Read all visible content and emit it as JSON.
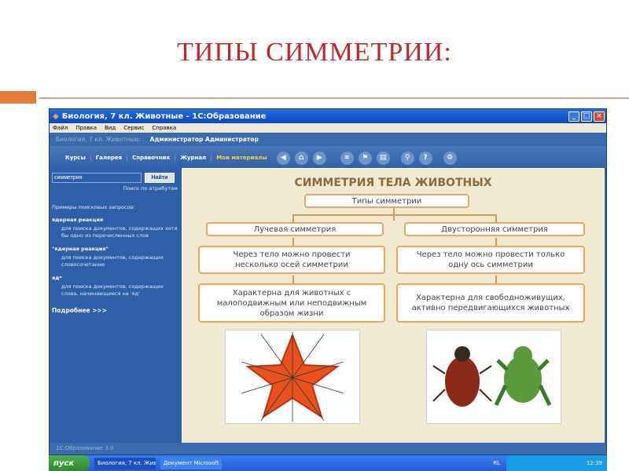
{
  "slide": {
    "title": "ТИПЫ СИММЕТРИИ:"
  },
  "window": {
    "title": "Биология, 7 кл. Животные - 1С:Образование",
    "menu": [
      "Файл",
      "Правка",
      "Вид",
      "Сервис",
      "Справка"
    ],
    "course": "Биология, 7 кл. Животные:",
    "user": "Администратор Администратор",
    "tabs": [
      "Курсы",
      "Галерея",
      "Справочник",
      "Журнал",
      "Мои материалы"
    ],
    "status": "1С:Образование 3.0"
  },
  "sidebar": {
    "search_value": "симметрия",
    "search_button": "Найти",
    "attr_link": "Поиск по атрибутам",
    "examples_title": "Примеры поисковых запросов:",
    "examples": [
      {
        "q": "ядерная реакция",
        "d": "для поиска документов, содержащих хотя бы одно из перечисленных слов"
      },
      {
        "q": "\"ядерная реакция\"",
        "d": "для поиска документов, содержащих словосочетание"
      },
      {
        "q": "яд*",
        "d": "для поиска документов, содержащих слова, начинающиеся на 'яд'"
      }
    ],
    "more": "Подробнее >>>"
  },
  "diagram": {
    "title": "СИММЕТРИЯ ТЕЛА ЖИВОТНЫХ",
    "root": "Типы симметрии",
    "left": {
      "type": "Лучевая симметрия",
      "axes": "Через тело можно провести несколько осей симметрии",
      "trait": "Характерна для животных с малоподвижным или неподвижным образом жизни"
    },
    "right": {
      "type": "Двусторонняя симметрия",
      "axes": "Через тело можно провести только одну ось симметрии",
      "trait": "Характерна для свободноживущих, активно передвигающихся животных"
    }
  },
  "taskbar": {
    "start": "пуск",
    "tasks": [
      "Биология, 7 кл. Жив...",
      "Документ Microsoft ..."
    ],
    "lang": "RL",
    "clock": "12:39"
  }
}
